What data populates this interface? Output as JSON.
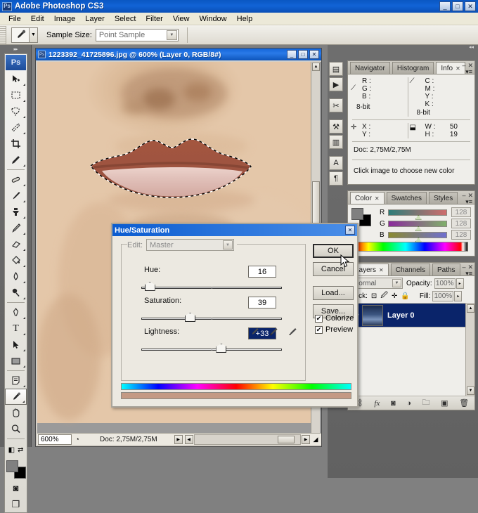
{
  "app": {
    "title": "Adobe Photoshop CS3",
    "logo_text": "Ps",
    "window_buttons": {
      "minimize": "_",
      "maximize": "□",
      "close": "✕"
    }
  },
  "menubar": {
    "items": [
      "File",
      "Edit",
      "Image",
      "Layer",
      "Select",
      "Filter",
      "View",
      "Window",
      "Help"
    ]
  },
  "options_bar": {
    "tool_icon": "eyedropper-icon",
    "dropdown_arrow": "▼",
    "sample_size_label": "Sample Size:",
    "sample_size_value": "Point Sample"
  },
  "toolbox": {
    "collapse_glyph": "▸▸",
    "logo": "Ps",
    "tools": [
      {
        "name": "move-tool",
        "glyph": "➚"
      },
      {
        "name": "marquee-tool",
        "glyph": "▭"
      },
      {
        "name": "lasso-tool",
        "glyph": "🪢"
      },
      {
        "name": "magic-wand-tool",
        "glyph": "✦"
      },
      {
        "name": "crop-tool",
        "glyph": "⌗"
      },
      {
        "name": "slice-tool",
        "glyph": "✎"
      },
      {
        "name": "healing-brush-tool",
        "glyph": "🩹"
      },
      {
        "name": "brush-tool",
        "glyph": "🖌"
      },
      {
        "name": "clone-stamp-tool",
        "glyph": "⚲"
      },
      {
        "name": "history-brush-tool",
        "glyph": "✍"
      },
      {
        "name": "eraser-tool",
        "glyph": "◳"
      },
      {
        "name": "gradient-tool",
        "glyph": "◨"
      },
      {
        "name": "blur-tool",
        "glyph": "💧"
      },
      {
        "name": "dodge-tool",
        "glyph": "🔍"
      },
      {
        "name": "pen-tool",
        "glyph": "✒"
      },
      {
        "name": "type-tool",
        "glyph": "T"
      },
      {
        "name": "path-selection-tool",
        "glyph": "➤"
      },
      {
        "name": "rectangle-tool",
        "glyph": "▬"
      },
      {
        "name": "notes-tool",
        "glyph": "🗒"
      },
      {
        "name": "eyedropper-tool",
        "glyph": "⟋"
      },
      {
        "name": "hand-tool",
        "glyph": "✋"
      },
      {
        "name": "zoom-tool",
        "glyph": "⌕"
      }
    ],
    "selected_tool": "eyedropper-tool",
    "foreground_color": "#808080",
    "background_color": "#000000",
    "quickmask_glyph": "◙",
    "screenmode_glyph": "❐"
  },
  "document": {
    "title": "1223392_41725896.jpg @ 600% (Layer 0, RGB/8#)",
    "window_buttons": {
      "minimize": "_",
      "maximize": "□",
      "close": "✕"
    },
    "status": {
      "zoom": "600%",
      "doc_info": "Doc: 2,75M/2,75M"
    }
  },
  "icon_dock": {
    "buttons": [
      {
        "name": "brush-presets-icon",
        "glyph": "▤"
      },
      {
        "name": "animation-icon",
        "glyph": "▶"
      },
      {
        "name": "tool-presets-icon",
        "glyph": "✂"
      },
      {
        "name": "clone-source-icon",
        "glyph": "⚒"
      },
      {
        "name": "layer-comps-icon",
        "glyph": "▥"
      },
      {
        "name": "character-icon",
        "glyph": "A"
      },
      {
        "name": "paragraph-icon",
        "glyph": "¶"
      }
    ]
  },
  "info_panel": {
    "tabs": [
      {
        "label": "Navigator",
        "active": false
      },
      {
        "label": "Histogram",
        "active": false
      },
      {
        "label": "Info",
        "active": true,
        "close": "✕"
      }
    ],
    "rgb": {
      "r": "R :",
      "g": "G :",
      "b": "B :",
      "depth": "8-bit"
    },
    "cmyk": {
      "c": "C :",
      "m": "M :",
      "y": "Y :",
      "k": "K :",
      "depth": "8-bit"
    },
    "position": {
      "x": "X :",
      "y": "Y :"
    },
    "size": {
      "w_label": "W :",
      "h_label": "H :",
      "w": "50",
      "h": "19"
    },
    "doc_size": "Doc: 2,75M/2,75M",
    "hint": "Click image to choose new color",
    "minimize_glyph": "–",
    "close_glyph": "✕",
    "menu_glyph": "▾≡"
  },
  "color_panel": {
    "tabs": [
      {
        "label": "Color",
        "active": true,
        "close": "✕"
      },
      {
        "label": "Swatches",
        "active": false
      },
      {
        "label": "Styles",
        "active": false
      }
    ],
    "channels": [
      {
        "label": "R",
        "value": "128"
      },
      {
        "label": "G",
        "value": "128"
      },
      {
        "label": "B",
        "value": "128"
      }
    ],
    "foreground_color": "#808080",
    "background_color": "#000000",
    "minimize_glyph": "–",
    "close_glyph": "✕",
    "menu_glyph": "▾≡"
  },
  "layers_panel": {
    "tabs": [
      {
        "label": "Layers",
        "active": true,
        "close": "✕"
      },
      {
        "label": "Channels",
        "active": false
      },
      {
        "label": "Paths",
        "active": false
      }
    ],
    "blend_mode": "Normal",
    "opacity_label": "Opacity:",
    "opacity_value": "100%",
    "lock_label": "Lock:",
    "lock_icons": [
      "transparency-lock-icon",
      "image-lock-icon",
      "position-lock-icon",
      "all-lock-icon"
    ],
    "fill_label": "Fill:",
    "fill_value": "100%",
    "layers": [
      {
        "name": "Layer 0",
        "visible": true,
        "selected": true,
        "eye_glyph": "👁"
      }
    ],
    "footer_icons": [
      {
        "name": "link-layers-icon",
        "glyph": "⛓"
      },
      {
        "name": "layer-style-icon",
        "glyph": "fx"
      },
      {
        "name": "layer-mask-icon",
        "glyph": "◙"
      },
      {
        "name": "adjustment-layer-icon",
        "glyph": "◑"
      },
      {
        "name": "new-group-icon",
        "glyph": "🗀"
      },
      {
        "name": "new-layer-icon",
        "glyph": "▣"
      },
      {
        "name": "delete-layer-icon",
        "glyph": "🗑"
      }
    ],
    "minimize_glyph": "–",
    "close_glyph": "✕",
    "menu_glyph": "▾≡"
  },
  "hue_saturation_dialog": {
    "title": "Hue/Saturation",
    "close_glyph": "✕",
    "edit_label": "Edit:",
    "edit_value": "Master",
    "sliders": [
      {
        "label": "Hue:",
        "value": "16",
        "thumb_percent": 2,
        "selected": false
      },
      {
        "label": "Saturation:",
        "value": "39",
        "thumb_percent": 33,
        "selected": false
      },
      {
        "label": "Lightness:",
        "value": "+33",
        "thumb_percent": 57,
        "selected": true
      }
    ],
    "buttons": [
      {
        "name": "ok-button",
        "label": "OK",
        "default": true
      },
      {
        "name": "cancel-button",
        "label": "Cancel",
        "default": false
      },
      {
        "name": "load-button",
        "label": "Load...",
        "default": false
      },
      {
        "name": "save-button",
        "label": "Save...",
        "default": false
      }
    ],
    "checkboxes": [
      {
        "name": "colorize-checkbox",
        "label": "Colorize",
        "checked": true,
        "mark": "✔"
      },
      {
        "name": "preview-checkbox",
        "label": "Preview",
        "checked": true,
        "mark": "✔"
      }
    ],
    "eyedroppers": [
      {
        "name": "eyedropper-sample-icon",
        "glyph": "⟋"
      },
      {
        "name": "eyedropper-add-icon",
        "glyph": "⟋"
      },
      {
        "name": "eyedropper-subtract-icon",
        "glyph": "⟋"
      }
    ],
    "result_color": "#c49a84"
  }
}
